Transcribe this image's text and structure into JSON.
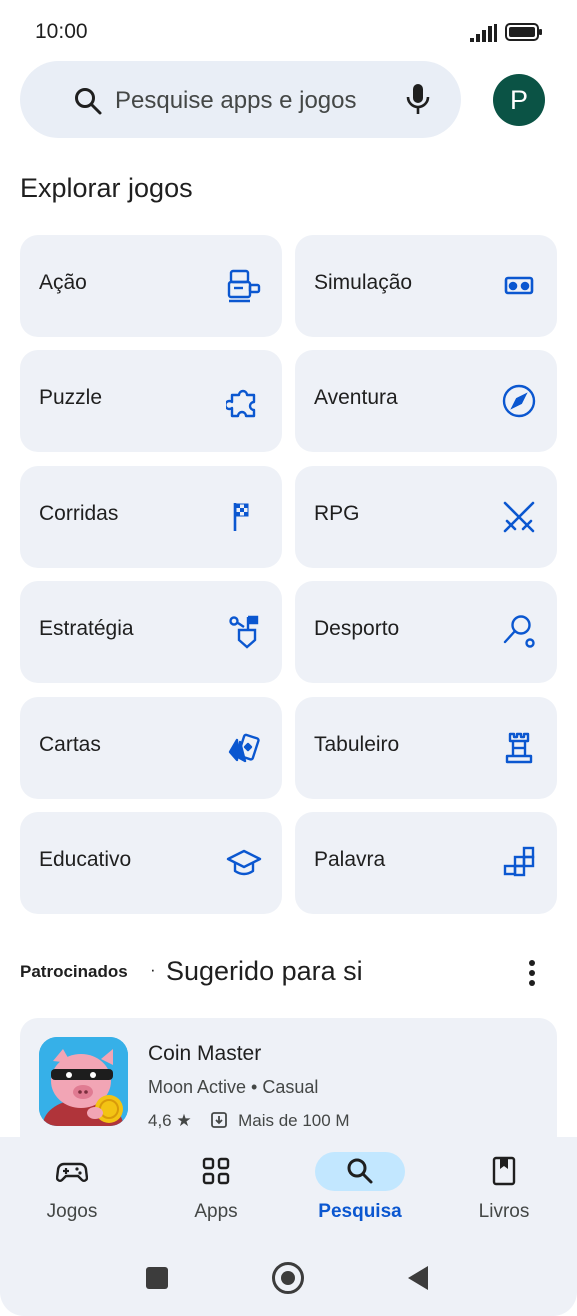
{
  "status_bar": {
    "time": "10:00"
  },
  "search": {
    "placeholder": "Pesquise apps e jogos",
    "avatar_letter": "P"
  },
  "section_title": "Explorar jogos",
  "categories": [
    {
      "label": "Ação",
      "icon": "arcade-icon"
    },
    {
      "label": "Simulação",
      "icon": "vr-headset-icon"
    },
    {
      "label": "Puzzle",
      "icon": "puzzle-piece-icon"
    },
    {
      "label": "Aventura",
      "icon": "compass-icon"
    },
    {
      "label": "Corridas",
      "icon": "checkered-flag-icon"
    },
    {
      "label": "RPG",
      "icon": "crossed-swords-icon"
    },
    {
      "label": "Estratégia",
      "icon": "strategy-flag-icon"
    },
    {
      "label": "Desporto",
      "icon": "racket-icon"
    },
    {
      "label": "Cartas",
      "icon": "playing-cards-icon"
    },
    {
      "label": "Tabuleiro",
      "icon": "chess-rook-icon"
    },
    {
      "label": "Educativo",
      "icon": "graduation-cap-icon"
    },
    {
      "label": "Palavra",
      "icon": "crossword-icon"
    }
  ],
  "sponsored": {
    "label": "Patrocinados",
    "separator": "·",
    "title": "Sugerido para si"
  },
  "app": {
    "name": "Coin Master",
    "meta": "Moon Active • Casual",
    "rating": "4,6 ★",
    "downloads": "Mais de 100 M"
  },
  "bottom_nav": [
    {
      "label": "Jogos",
      "icon": "gamepad-icon",
      "active": false
    },
    {
      "label": "Apps",
      "icon": "apps-grid-icon",
      "active": false
    },
    {
      "label": "Pesquisa",
      "icon": "search-icon",
      "active": true
    },
    {
      "label": "Livros",
      "icon": "bookmark-book-icon",
      "active": false
    }
  ],
  "colors": {
    "accent": "#0b57d0",
    "icon_blue": "#0b57d0",
    "card_bg": "#eef1f7",
    "search_bg": "#e9eef6",
    "avatar_bg": "#0b5345",
    "active_pill": "#c2e7ff"
  }
}
